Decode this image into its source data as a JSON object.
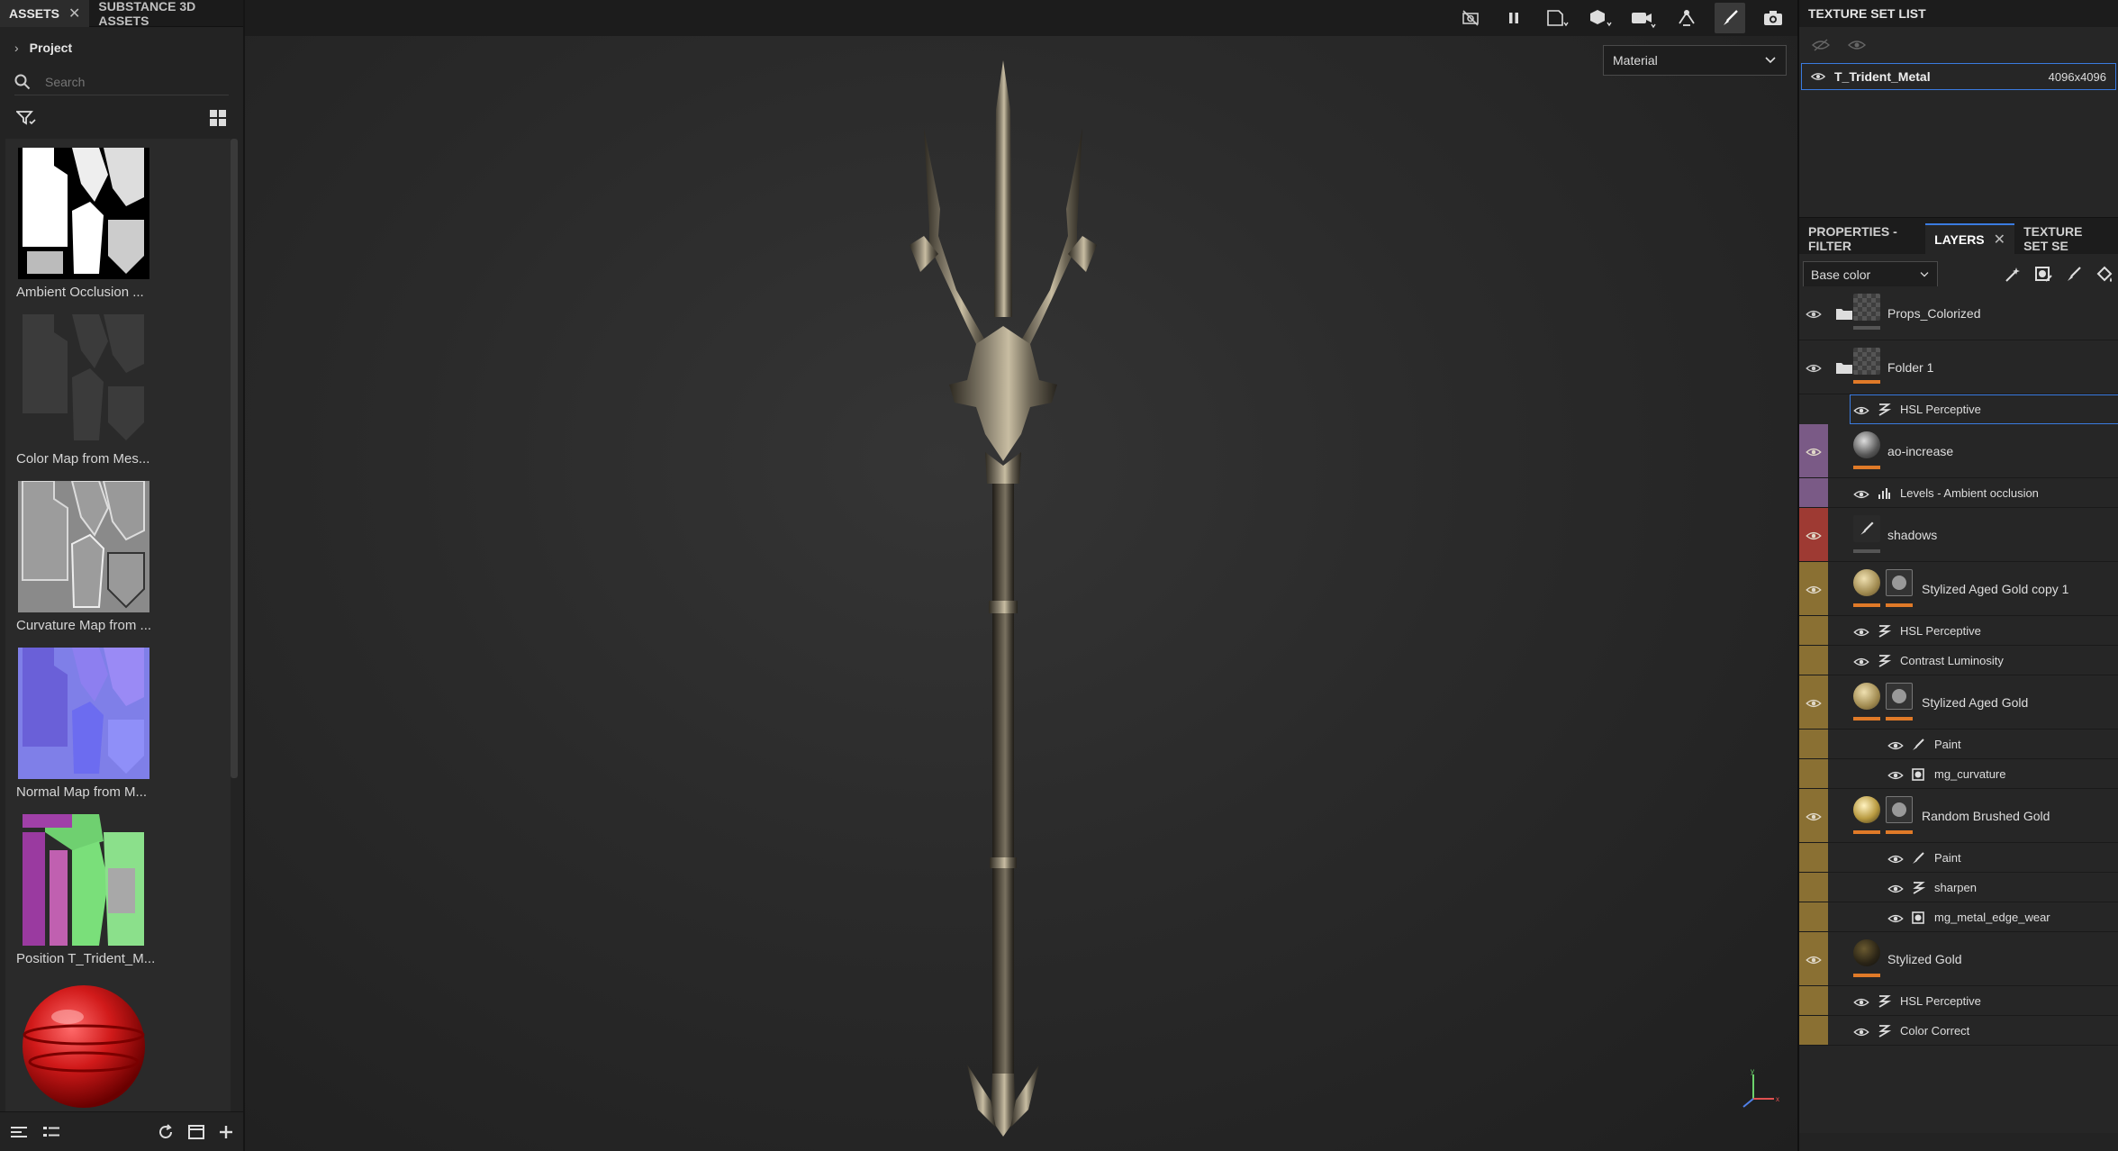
{
  "left_panel": {
    "tabs": [
      "ASSETS",
      "SUBSTANCE 3D ASSETS"
    ],
    "project_label": "Project",
    "search_placeholder": "Search",
    "assets": [
      {
        "label": "Ambient Occlusion ...",
        "kind": "ao"
      },
      {
        "label": "Color Map from Mes...",
        "kind": "color"
      },
      {
        "label": "Curvature Map from ...",
        "kind": "curvature"
      },
      {
        "label": "Normal Map from M...",
        "kind": "normal"
      },
      {
        "label": "Position T_Trident_M...",
        "kind": "position"
      },
      {
        "label": "",
        "kind": "material-ball"
      }
    ]
  },
  "viewport": {
    "toolbar_icons": [
      "camera-off-icon",
      "pause-icon",
      "display-2d-icon",
      "display-3d-icon",
      "camera-icon",
      "light-icon",
      "paint-brush-icon",
      "screenshot-icon"
    ],
    "material_select": "Material",
    "axis_labels": {
      "x": "x",
      "y": "y"
    }
  },
  "texture_set_list": {
    "title": "TEXTURE SET LIST",
    "item": {
      "name": "T_Trident_Metal",
      "resolution": "4096x4096"
    }
  },
  "layers_panel": {
    "tabs": [
      "PROPERTIES - FILTER",
      "LAYERS",
      "TEXTURE SET SE"
    ],
    "channel_select": "Base color",
    "layers": [
      {
        "name": "Props_Colorized",
        "type": "folder",
        "stripe": "",
        "indent": 0
      },
      {
        "name": "Folder 1",
        "type": "folder-open",
        "stripe": "",
        "indent": 0
      },
      {
        "name": "HSL Perceptive",
        "type": "filter",
        "stripe": "",
        "indent": 1,
        "selected": true
      },
      {
        "name": "ao-increase",
        "type": "fill",
        "stripe": "#7a5a86",
        "indent": 0
      },
      {
        "name": "Levels - Ambient occlusion",
        "type": "levels",
        "stripe": "#7a5a86",
        "indent": 1
      },
      {
        "name": "shadows",
        "type": "paint",
        "stripe": "#9e3a33",
        "indent": 0
      },
      {
        "name": "Stylized Aged Gold copy 1",
        "type": "fill-mask",
        "stripe": "#8a7033",
        "indent": 0
      },
      {
        "name": "HSL Perceptive",
        "type": "filter",
        "stripe": "#8a7033",
        "indent": 1
      },
      {
        "name": "Contrast Luminosity",
        "type": "filter",
        "stripe": "#8a7033",
        "indent": 1
      },
      {
        "name": "Stylized Aged Gold",
        "type": "fill-mask",
        "stripe": "#8a7033",
        "indent": 0
      },
      {
        "name": "Paint",
        "type": "paint",
        "stripe": "#8a7033",
        "indent": 2
      },
      {
        "name": "mg_curvature",
        "type": "mask",
        "stripe": "#8a7033",
        "indent": 2
      },
      {
        "name": "Random Brushed Gold",
        "type": "fill-mask",
        "stripe": "#8a7033",
        "indent": 0
      },
      {
        "name": "Paint",
        "type": "paint",
        "stripe": "#8a7033",
        "indent": 2
      },
      {
        "name": "sharpen",
        "type": "filter",
        "stripe": "#8a7033",
        "indent": 2
      },
      {
        "name": "mg_metal_edge_wear",
        "type": "mask",
        "stripe": "#8a7033",
        "indent": 2
      },
      {
        "name": "Stylized Gold",
        "type": "fill",
        "stripe": "#8a7033",
        "indent": 0
      },
      {
        "name": "HSL Perceptive",
        "type": "filter",
        "stripe": "#8a7033",
        "indent": 1
      },
      {
        "name": "Color Correct",
        "type": "filter",
        "stripe": "#8a7033",
        "indent": 1
      }
    ]
  },
  "colors": {
    "accent": "#3a7be0",
    "orange": "#e07a28"
  }
}
